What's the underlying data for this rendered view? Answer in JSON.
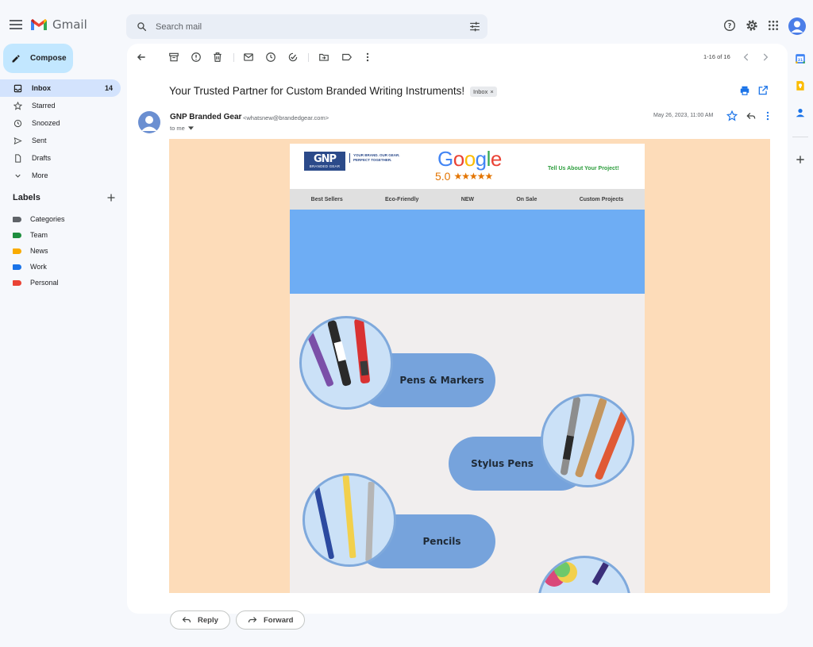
{
  "app": {
    "name": "Gmail"
  },
  "search": {
    "placeholder": "Search mail"
  },
  "compose": {
    "label": "Compose"
  },
  "nav": {
    "items": [
      {
        "label": "Inbox",
        "count": "14"
      },
      {
        "label": "Starred"
      },
      {
        "label": "Snoozed"
      },
      {
        "label": "Sent"
      },
      {
        "label": "Drafts"
      },
      {
        "label": "More"
      }
    ]
  },
  "labels": {
    "title": "Labels",
    "items": [
      {
        "label": "Categories",
        "color": "#5f6368"
      },
      {
        "label": "Team",
        "color": "#1e8e3e"
      },
      {
        "label": "News",
        "color": "#f9ab00"
      },
      {
        "label": "Work",
        "color": "#1a73e8"
      },
      {
        "label": "Personal",
        "color": "#ea4335"
      }
    ]
  },
  "toolbar": {
    "pager": "1-16 of 16"
  },
  "email": {
    "subject": "Your Trusted Partner for Custom Branded Writing Instruments!",
    "badge": "Inbox",
    "sender_name": "GNP Branded Gear",
    "sender_email": "<whatsnew@brandedgear.com>",
    "to": "to me",
    "date": "May 26, 2023, 11:00 AM"
  },
  "newsletter": {
    "logo_main": "GNP",
    "logo_sub": "BRANDED GEAR",
    "tagline_1": "YOUR BRAND. OUR GEAR.",
    "tagline_2": "PERFECT TOGETHER.",
    "google_word": "Google",
    "rating": "5.0",
    "stars": "★★★★★",
    "cta": "Tell Us About Your Project!",
    "nav": [
      "Best Sellers",
      "Eco-Friendly",
      "NEW",
      "On Sale",
      "Custom Projects"
    ],
    "categories": [
      "Pens & Markers",
      "Stylus Pens",
      "Pencils"
    ]
  },
  "actions": {
    "reply": "Reply",
    "forward": "Forward"
  },
  "colors": {
    "accent": "#c2e7ff",
    "active_nav": "#d3e3fd",
    "email_bg": "#fddcb9",
    "hero": "#6eadf4",
    "pill": "#76a3dc"
  }
}
